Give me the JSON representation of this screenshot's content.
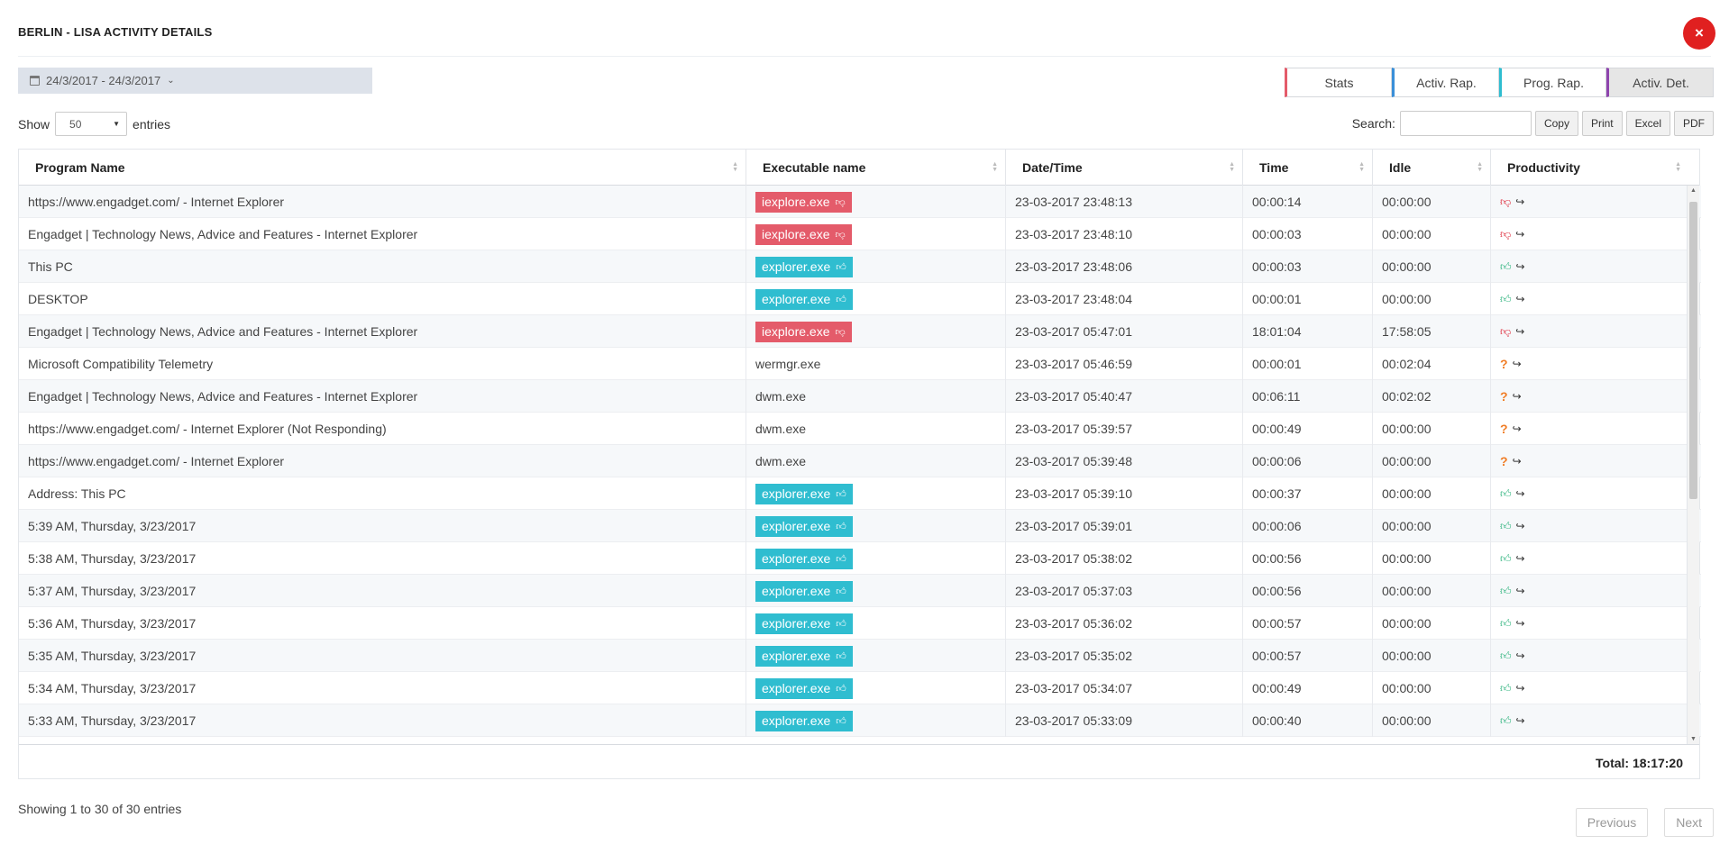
{
  "modal": {
    "title": "BERLIN - LISA ACTIVITY DETAILS",
    "close_glyph": "×"
  },
  "date_range": {
    "value": "24/3/2017 - 24/3/2017",
    "icon": "calendar-icon"
  },
  "report_tabs": [
    {
      "label": "Stats",
      "accent": "#e45b6a",
      "active": false
    },
    {
      "label": "Activ. Rap.",
      "accent": "#3a8fd8",
      "active": false
    },
    {
      "label": "Prog. Rap.",
      "accent": "#2fbdd0",
      "active": false
    },
    {
      "label": "Activ. Det.",
      "accent": "#8e44ad",
      "active": true
    }
  ],
  "length_menu": {
    "prefix": "Show",
    "value": "50",
    "suffix": "entries"
  },
  "search": {
    "label": "Search:",
    "value": ""
  },
  "export_buttons": [
    "Copy",
    "Print",
    "Excel",
    "PDF"
  ],
  "table": {
    "columns": [
      "Program Name",
      "Executable name",
      "Date/Time",
      "Time",
      "Idle",
      "Productivity"
    ],
    "rows": [
      {
        "program": "https://www.engadget.com/ - Internet Explorer",
        "exe": "iexplore.exe",
        "status": "bad",
        "datetime": "23-03-2017 23:48:13",
        "time": "00:00:14",
        "idle": "00:00:00"
      },
      {
        "program": "Engadget | Technology News, Advice and Features - Internet Explorer",
        "exe": "iexplore.exe",
        "status": "bad",
        "datetime": "23-03-2017 23:48:10",
        "time": "00:00:03",
        "idle": "00:00:00"
      },
      {
        "program": "This PC",
        "exe": "explorer.exe",
        "status": "good",
        "datetime": "23-03-2017 23:48:06",
        "time": "00:00:03",
        "idle": "00:00:00"
      },
      {
        "program": "DESKTOP",
        "exe": "explorer.exe",
        "status": "good",
        "datetime": "23-03-2017 23:48:04",
        "time": "00:00:01",
        "idle": "00:00:00"
      },
      {
        "program": "Engadget | Technology News, Advice and Features - Internet Explorer",
        "exe": "iexplore.exe",
        "status": "bad",
        "datetime": "23-03-2017 05:47:01",
        "time": "18:01:04",
        "idle": "17:58:05"
      },
      {
        "program": "Microsoft Compatibility Telemetry",
        "exe": "wermgr.exe",
        "status": "unknown",
        "datetime": "23-03-2017 05:46:59",
        "time": "00:00:01",
        "idle": "00:02:04"
      },
      {
        "program": "Engadget | Technology News, Advice and Features - Internet Explorer",
        "exe": "dwm.exe",
        "status": "unknown",
        "datetime": "23-03-2017 05:40:47",
        "time": "00:06:11",
        "idle": "00:02:02"
      },
      {
        "program": "https://www.engadget.com/ - Internet Explorer (Not Responding)",
        "exe": "dwm.exe",
        "status": "unknown",
        "datetime": "23-03-2017 05:39:57",
        "time": "00:00:49",
        "idle": "00:00:00"
      },
      {
        "program": "https://www.engadget.com/ - Internet Explorer",
        "exe": "dwm.exe",
        "status": "unknown",
        "datetime": "23-03-2017 05:39:48",
        "time": "00:00:06",
        "idle": "00:00:00"
      },
      {
        "program": "Address: This PC",
        "exe": "explorer.exe",
        "status": "good",
        "datetime": "23-03-2017 05:39:10",
        "time": "00:00:37",
        "idle": "00:00:00"
      },
      {
        "program": "5:39 AM, Thursday, 3/23/2017",
        "exe": "explorer.exe",
        "status": "good",
        "datetime": "23-03-2017 05:39:01",
        "time": "00:00:06",
        "idle": "00:00:00"
      },
      {
        "program": "5:38 AM, Thursday, 3/23/2017",
        "exe": "explorer.exe",
        "status": "good",
        "datetime": "23-03-2017 05:38:02",
        "time": "00:00:56",
        "idle": "00:00:00"
      },
      {
        "program": "5:37 AM, Thursday, 3/23/2017",
        "exe": "explorer.exe",
        "status": "good",
        "datetime": "23-03-2017 05:37:03",
        "time": "00:00:56",
        "idle": "00:00:00"
      },
      {
        "program": "5:36 AM, Thursday, 3/23/2017",
        "exe": "explorer.exe",
        "status": "good",
        "datetime": "23-03-2017 05:36:02",
        "time": "00:00:57",
        "idle": "00:00:00"
      },
      {
        "program": "5:35 AM, Thursday, 3/23/2017",
        "exe": "explorer.exe",
        "status": "good",
        "datetime": "23-03-2017 05:35:02",
        "time": "00:00:57",
        "idle": "00:00:00"
      },
      {
        "program": "5:34 AM, Thursday, 3/23/2017",
        "exe": "explorer.exe",
        "status": "good",
        "datetime": "23-03-2017 05:34:07",
        "time": "00:00:49",
        "idle": "00:00:00"
      },
      {
        "program": "5:33 AM, Thursday, 3/23/2017",
        "exe": "explorer.exe",
        "status": "good",
        "datetime": "23-03-2017 05:33:09",
        "time": "00:00:40",
        "idle": "00:00:00"
      }
    ],
    "total": "Total: 18:17:20"
  },
  "info": "Showing 1 to 30 of 30 entries",
  "pagination": {
    "previous": "Previous",
    "next": "Next"
  },
  "colors": {
    "bad": "#e45b6a",
    "good": "#2fbdd0",
    "unknown": "#f07d26"
  }
}
